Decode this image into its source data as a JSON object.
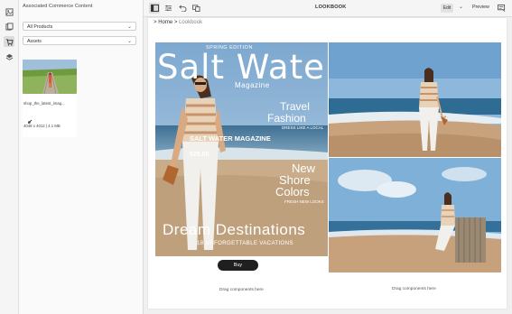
{
  "panel": {
    "title": "Associated Commerce Content",
    "product_select": "All Products",
    "type_select": "Assets",
    "asset_name": "shop_the_latest_imag...",
    "asset_meta": "4048 x 4012 | 4.1 MB"
  },
  "toolbar": {
    "title": "LOOKBOOK",
    "edit": "Edit",
    "preview": "Preview"
  },
  "breadcrumb": {
    "separator": ">",
    "home": "Home",
    "current": "Lookbook"
  },
  "magazine": {
    "edition": "SPRING EDITION",
    "title": "Salt Water",
    "subtitle": "Magazine",
    "travel": "Travel",
    "fashion": "Fashion",
    "dress_tagline": "DRESS LIKE A LOCAL",
    "masthead": "SALT WATER MAGAZINE",
    "price": "$25.00",
    "new": "New",
    "shore": "Shore",
    "colors": "Colors",
    "colors_tagline": "FRESH NEW LOOKS",
    "dream": "Dream Destinations",
    "vacations": "18 UNFORGETTABLE VACATIONS"
  },
  "buy_label": "Buy",
  "drag_left": "Drag components here",
  "drag_right": "Drag components here",
  "icons": {
    "rail": [
      "assets-icon",
      "content-fragment-icon",
      "commerce-icon",
      "layers-icon"
    ],
    "toolbar": [
      "side-panel-icon",
      "properties-icon",
      "undo-icon",
      "redo-icon",
      "emulator-icon"
    ]
  }
}
